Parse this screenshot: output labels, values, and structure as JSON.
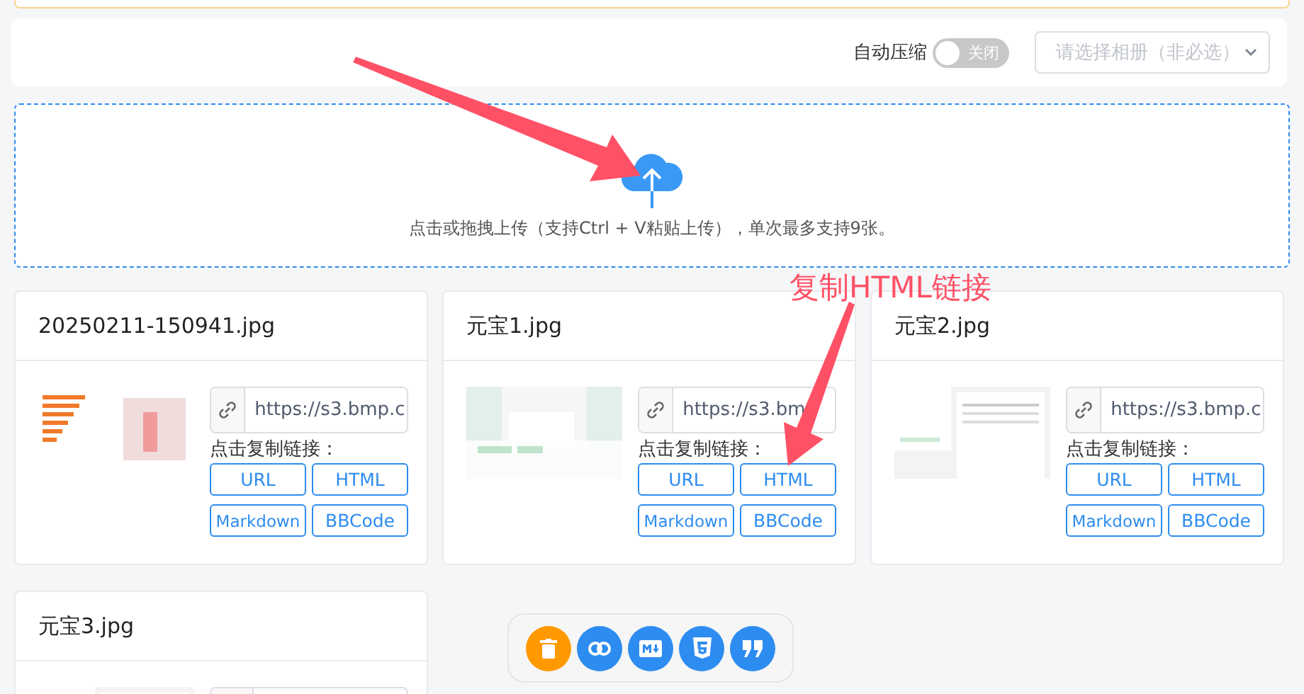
{
  "toolbar": {
    "compress_label": "自动压缩",
    "compress_switch": {
      "on": false,
      "text": "关闭"
    },
    "album_select": {
      "placeholder": "请选择相册（非必选）"
    }
  },
  "upload_zone": {
    "hint": "点击或拖拽上传（支持Ctrl + V粘贴上传），单次最多支持9张。"
  },
  "files": [
    {
      "name": "20250211-150941.jpg",
      "url": "https://s3.bmp.c",
      "copy_label": "点击复制链接：",
      "buttons": [
        "URL",
        "HTML",
        "Markdown",
        "BBCode"
      ],
      "thumbnail": {
        "kind": "picture"
      }
    },
    {
      "name": "元宝1.jpg",
      "url": "https://s3.bm",
      "copy_label": "点击复制链接：",
      "buttons": [
        "URL",
        "HTML",
        "Markdown",
        "BBCode"
      ],
      "thumbnail": {
        "kind": "picture"
      }
    },
    {
      "name": "元宝2.jpg",
      "url": "https://s3.bmp.c",
      "copy_label": "点击复制链接：",
      "buttons": [
        "URL",
        "HTML",
        "Markdown",
        "BBCode"
      ],
      "thumbnail": {
        "kind": "picture"
      }
    },
    {
      "name": "元宝3.jpg",
      "thumbnail": {
        "kind": "picture"
      }
    }
  ],
  "action_bar": [
    {
      "kind": "delete"
    },
    {
      "kind": "link"
    },
    {
      "kind": "markdown"
    },
    {
      "kind": "html"
    },
    {
      "kind": "quote"
    }
  ],
  "annotation": {
    "text": "复制HTML链接"
  }
}
